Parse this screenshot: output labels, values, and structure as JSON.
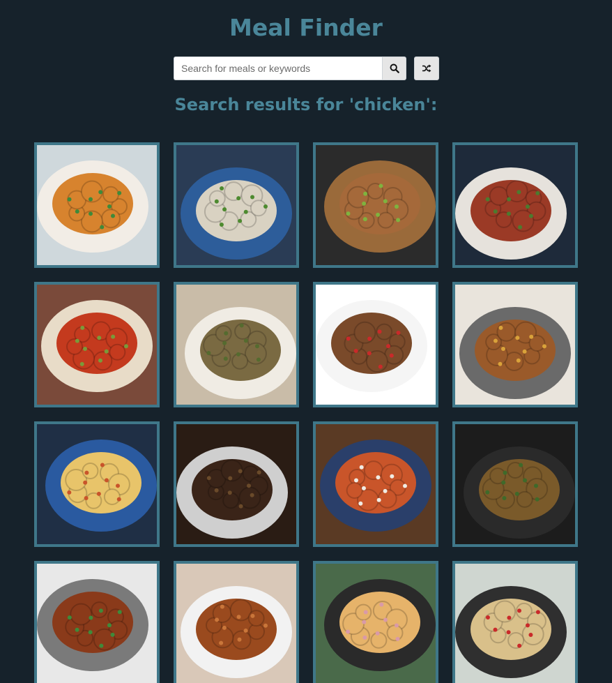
{
  "app": {
    "title": "Meal Finder"
  },
  "search": {
    "placeholder": "Search for meals or keywords",
    "value": "",
    "search_icon": "search-icon",
    "random_icon": "shuffle-icon"
  },
  "results": {
    "heading": "Search results for 'chicken':",
    "meals": [
      {
        "plate": "#f2ede6",
        "food": "#d7832e",
        "accent": "#3f8a3a",
        "bg": "#cfd8dc"
      },
      {
        "plate": "#2d5d9a",
        "food": "#d9d2c2",
        "accent": "#4d8a2f",
        "bg": "#2a3c55"
      },
      {
        "plate": "#9a6a3a",
        "food": "#a5693a",
        "accent": "#7fb33f",
        "bg": "#2b2b2b"
      },
      {
        "plate": "#e6e2dc",
        "food": "#9b3a26",
        "accent": "#4d7a2f",
        "bg": "#1e2a3a"
      },
      {
        "plate": "#e8dcc8",
        "food": "#c43a1e",
        "accent": "#7a9a3a",
        "bg": "#7a4a3a"
      },
      {
        "plate": "#f0ece4",
        "food": "#7a6a42",
        "accent": "#556b2f",
        "bg": "#c9bca8"
      },
      {
        "plate": "#f5f5f5",
        "food": "#7a4a2a",
        "accent": "#c92a2a",
        "bg": "#ffffff"
      },
      {
        "plate": "#6a6a6a",
        "food": "#9a5a2a",
        "accent": "#d9a23a",
        "bg": "#e9e4dc"
      },
      {
        "plate": "#2a5aa0",
        "food": "#e8c46a",
        "accent": "#c9542a",
        "bg": "#1f2f45"
      },
      {
        "plate": "#cfcfcf",
        "food": "#3a2418",
        "accent": "#6a4a2a",
        "bg": "#2a1c14"
      },
      {
        "plate": "#2a3f6a",
        "food": "#c9552a",
        "accent": "#f0ece4",
        "bg": "#5a3a24"
      },
      {
        "plate": "#2a2a2a",
        "food": "#7a5a2a",
        "accent": "#3f6a2a",
        "bg": "#1c1c1c"
      },
      {
        "plate": "#7a7a7a",
        "food": "#8a3a1a",
        "accent": "#3f8a3a",
        "bg": "#e8e8e8"
      },
      {
        "plate": "#f2f2f2",
        "food": "#9a4a1e",
        "accent": "#c9763a",
        "bg": "#d9c8b8"
      },
      {
        "plate": "#2a2a2a",
        "food": "#e6b36a",
        "accent": "#d99aa8",
        "bg": "#4a6a4a"
      },
      {
        "plate": "#2f2f2f",
        "food": "#d9c08a",
        "accent": "#c92a2a",
        "bg": "#cfd6d0"
      }
    ]
  }
}
